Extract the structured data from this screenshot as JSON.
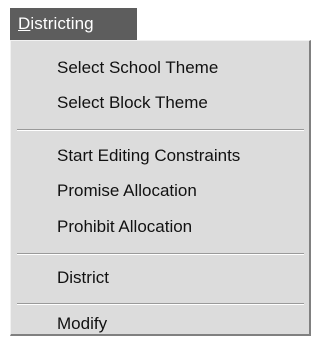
{
  "menu": {
    "title_mnemonic": "D",
    "title_rest": "istricting",
    "items": [
      {
        "label": "Select School Theme"
      },
      {
        "label": "Select Block Theme"
      },
      {
        "label": "Start Editing Constraints"
      },
      {
        "label": "Promise Allocation"
      },
      {
        "label": "Prohibit Allocation"
      },
      {
        "label": "District"
      },
      {
        "label": "Modify"
      }
    ]
  },
  "colors": {
    "header_bg": "#5d5d5d",
    "header_text": "#ffffff",
    "menu_bg": "#dcdcdc",
    "menu_text": "#111111"
  }
}
